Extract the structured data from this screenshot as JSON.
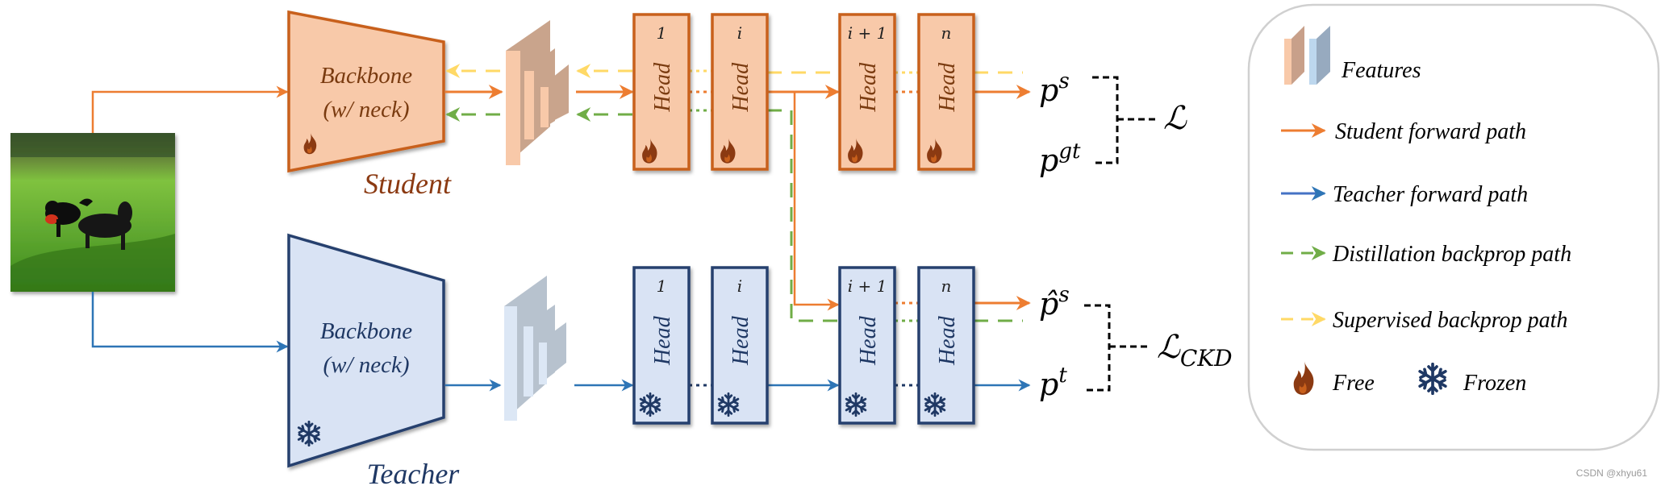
{
  "colors": {
    "student_fill": "#f8c9a9",
    "student_stroke": "#c8601c",
    "student_text": "#7a3b10",
    "teacher_fill": "#d9e3f4",
    "teacher_stroke": "#25406e",
    "teacher_text": "#1f3864",
    "student_forward": "#ed7d31",
    "teacher_forward": "#2e75b6",
    "distill_backprop": "#70ad47",
    "supervised_backprop": "#ffd966",
    "loss_bracket": "#000000",
    "legend_border": "#d0d0d0"
  },
  "input": {
    "label": "input-image-dogs-on-grass"
  },
  "student": {
    "label": "Student",
    "backbone_line1": "Backbone",
    "backbone_line2": "(w/ neck)",
    "state_icon": "fire-icon",
    "heads": [
      {
        "index": "1",
        "label": "Head"
      },
      {
        "index": "i",
        "label": "Head"
      },
      {
        "index": "i + 1",
        "label": "Head"
      },
      {
        "index": "n",
        "label": "Head"
      }
    ]
  },
  "teacher": {
    "label": "Teacher",
    "backbone_line1": "Backbone",
    "backbone_line2": "(w/ neck)",
    "state_icon": "snowflake-icon",
    "heads": [
      {
        "index": "1",
        "label": "Head"
      },
      {
        "index": "i",
        "label": "Head"
      },
      {
        "index": "i + 1",
        "label": "Head"
      },
      {
        "index": "n",
        "label": "Head"
      }
    ]
  },
  "outputs": {
    "p_s": {
      "base": "p",
      "sup": "s"
    },
    "p_gt": {
      "base": "p",
      "sup": "gt"
    },
    "p_hat_s": {
      "base": "p̂",
      "sup": "s"
    },
    "p_t": {
      "base": "p",
      "sup": "t"
    }
  },
  "losses": {
    "L": {
      "base": "ℒ",
      "sub": ""
    },
    "L_ckd": {
      "base": "ℒ",
      "sub": "CKD"
    }
  },
  "legend": {
    "features": "Features",
    "student_forward": "Student forward path",
    "teacher_forward": "Teacher forward path",
    "distill_backprop": "Distillation backprop path",
    "supervised_backprop": "Supervised backprop path",
    "free": "Free",
    "frozen": "Frozen"
  },
  "watermark": "CSDN @xhyu61"
}
